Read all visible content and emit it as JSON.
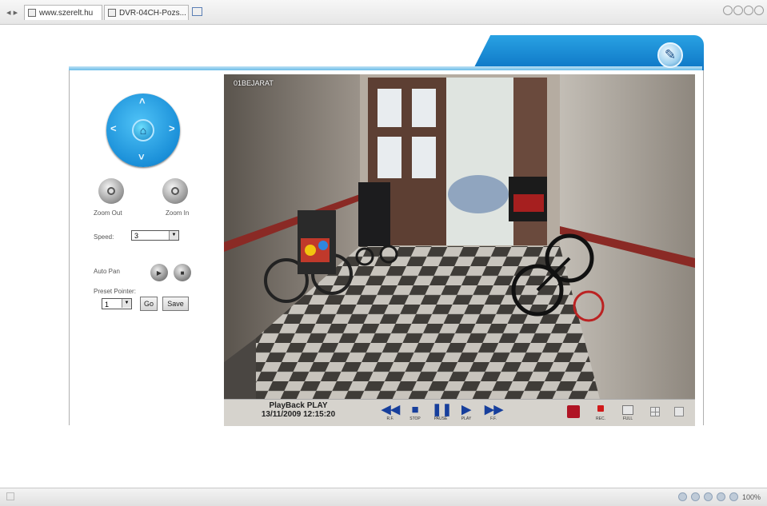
{
  "browser": {
    "tabs": [
      {
        "label": "www.szerelt.hu"
      },
      {
        "label": "DVR-04CH-Pozs..."
      }
    ],
    "status": {
      "zoom": "100%"
    }
  },
  "ptz": {
    "zoom_out_label": "Zoom Out",
    "zoom_in_label": "Zoom In",
    "speed_label": "Speed:",
    "speed_value": "3",
    "auto_pan_label": "Auto Pan",
    "preset_label": "Preset Pointer:",
    "preset_value": "1",
    "go_label": "Go",
    "save_label": "Save"
  },
  "video": {
    "camera_name": "01BEJARAT"
  },
  "playback": {
    "status_line": "PlayBack  PLAY",
    "timestamp": "13/11/2009 12:15:20",
    "buttons": [
      {
        "caption": "R.F."
      },
      {
        "caption": "STOP"
      },
      {
        "caption": "PAUSE"
      },
      {
        "caption": "PLAY"
      },
      {
        "caption": "F.F."
      }
    ],
    "right_buttons": [
      {
        "caption": "REC."
      },
      {
        "caption": "FULL"
      }
    ]
  },
  "colors": {
    "accent": "#1a8fd8",
    "header": "#0c74c4",
    "control_icons": "#173f9c"
  }
}
